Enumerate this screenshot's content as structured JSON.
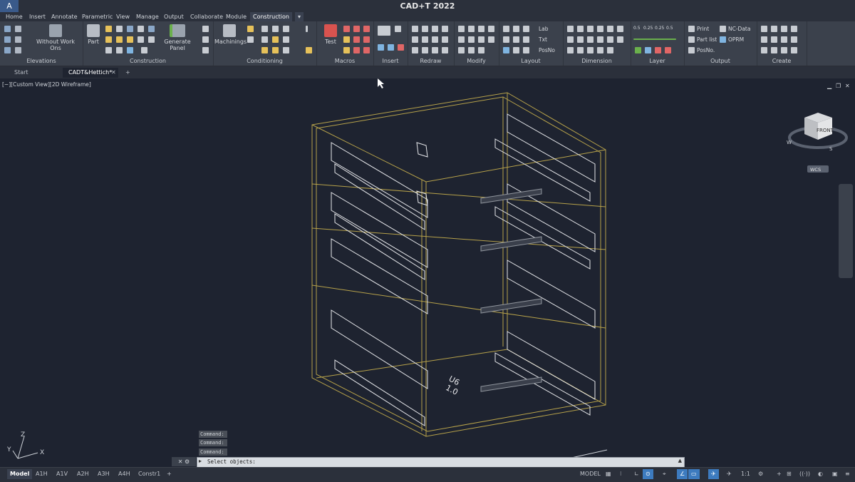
{
  "app": {
    "title": "CAD+T 2022",
    "logo": "A"
  },
  "menu_tabs": [
    "Home",
    "Insert",
    "Annotate",
    "Parametric",
    "View",
    "Manage",
    "Output",
    "Collaborate",
    "Module",
    "Construction"
  ],
  "ribbon": {
    "panels": [
      "Elevations",
      "Construction",
      "Conditioning",
      "Macros",
      "Insert",
      "Redraw",
      "Modify",
      "Layout",
      "Dimension",
      "Layer",
      "Output",
      "Create"
    ],
    "without_work_ons": "Without Work Ons",
    "part": "Part",
    "generate_panel": "Generate Panel",
    "machinings": "Machinings",
    "test": "Test",
    "lab": "Lab",
    "txt": "Txt",
    "posno": "PosNo",
    "print": "Print",
    "part_list": "Part list",
    "posno2": "PosNo.",
    "nc_data": "NC-Data",
    "oprm": "OPRM",
    "dim_values": [
      "0.5",
      "0.25",
      "0.25",
      "0.5"
    ]
  },
  "doc_tabs": {
    "start": "Start",
    "active": "CADT&Hettich*"
  },
  "viewport": {
    "label": "[−][Custom View][2D Wireframe]",
    "viewcube_face": "FRONT",
    "viewcube_dirs": {
      "w": "W",
      "s": "S"
    },
    "wcs": "WCS",
    "axis": {
      "x": "X",
      "y": "Y",
      "z": "Z"
    },
    "model_tag": [
      "U6",
      "1.0"
    ]
  },
  "command": {
    "history": [
      "Command:",
      "Command:",
      "Command:"
    ],
    "prompt": "Select objects:"
  },
  "layout_tabs": [
    "Model",
    "A1H",
    "A1V",
    "A2H",
    "A3H",
    "A4H",
    "Constr1"
  ],
  "status": {
    "model": "MODEL",
    "scale": "1:1"
  }
}
